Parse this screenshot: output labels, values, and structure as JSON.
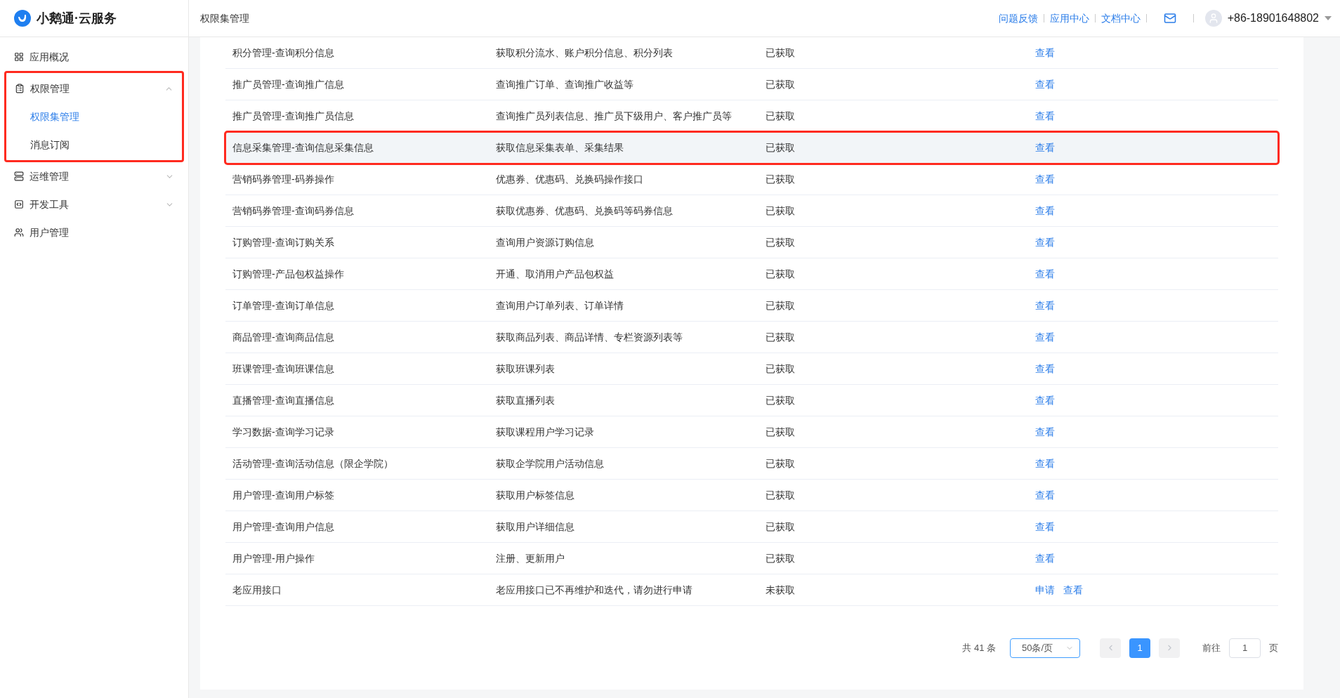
{
  "brand": {
    "name": "小鹅通·云服务"
  },
  "header": {
    "title": "权限集管理",
    "links": [
      "问题反馈",
      "应用中心",
      "文档中心"
    ],
    "user": "+86-18901648802"
  },
  "sidebar": {
    "items": [
      {
        "label": "应用概况"
      },
      {
        "label": "权限管理",
        "expanded": true,
        "annotated": true,
        "children": [
          {
            "label": "权限集管理",
            "selected": true
          },
          {
            "label": "消息订阅",
            "selected": false
          }
        ]
      },
      {
        "label": "运维管理",
        "expanded": false
      },
      {
        "label": "开发工具",
        "expanded": false
      },
      {
        "label": "用户管理"
      }
    ]
  },
  "table": {
    "rows": [
      {
        "name": "积分管理-查询积分信息",
        "description": "获取积分流水、账户积分信息、积分列表",
        "status": "已获取",
        "actions": [
          "查看"
        ],
        "highlighted": false,
        "annotated": false
      },
      {
        "name": "推广员管理-查询推广信息",
        "description": "查询推广订单、查询推广收益等",
        "status": "已获取",
        "actions": [
          "查看"
        ],
        "highlighted": false,
        "annotated": false
      },
      {
        "name": "推广员管理-查询推广员信息",
        "description": "查询推广员列表信息、推广员下级用户、客户推广员等",
        "status": "已获取",
        "actions": [
          "查看"
        ],
        "highlighted": false,
        "annotated": false
      },
      {
        "name": "信息采集管理-查询信息采集信息",
        "description": "获取信息采集表单、采集结果",
        "status": "已获取",
        "actions": [
          "查看"
        ],
        "highlighted": true,
        "annotated": true
      },
      {
        "name": "营销码券管理-码券操作",
        "description": "优惠券、优惠码、兑换码操作接口",
        "status": "已获取",
        "actions": [
          "查看"
        ],
        "highlighted": false,
        "annotated": false
      },
      {
        "name": "营销码券管理-查询码券信息",
        "description": "获取优惠券、优惠码、兑换码等码券信息",
        "status": "已获取",
        "actions": [
          "查看"
        ],
        "highlighted": false,
        "annotated": false
      },
      {
        "name": "订购管理-查询订购关系",
        "description": "查询用户资源订购信息",
        "status": "已获取",
        "actions": [
          "查看"
        ],
        "highlighted": false,
        "annotated": false
      },
      {
        "name": "订购管理-产品包权益操作",
        "description": "开通、取消用户产品包权益",
        "status": "已获取",
        "actions": [
          "查看"
        ],
        "highlighted": false,
        "annotated": false
      },
      {
        "name": "订单管理-查询订单信息",
        "description": "查询用户订单列表、订单详情",
        "status": "已获取",
        "actions": [
          "查看"
        ],
        "highlighted": false,
        "annotated": false
      },
      {
        "name": "商品管理-查询商品信息",
        "description": "获取商品列表、商品详情、专栏资源列表等",
        "status": "已获取",
        "actions": [
          "查看"
        ],
        "highlighted": false,
        "annotated": false
      },
      {
        "name": "班课管理-查询班课信息",
        "description": "获取班课列表",
        "status": "已获取",
        "actions": [
          "查看"
        ],
        "highlighted": false,
        "annotated": false
      },
      {
        "name": "直播管理-查询直播信息",
        "description": "获取直播列表",
        "status": "已获取",
        "actions": [
          "查看"
        ],
        "highlighted": false,
        "annotated": false
      },
      {
        "name": "学习数据-查询学习记录",
        "description": "获取课程用户学习记录",
        "status": "已获取",
        "actions": [
          "查看"
        ],
        "highlighted": false,
        "annotated": false
      },
      {
        "name": "活动管理-查询活动信息（限企学院）",
        "description": "获取企学院用户活动信息",
        "status": "已获取",
        "actions": [
          "查看"
        ],
        "highlighted": false,
        "annotated": false
      },
      {
        "name": "用户管理-查询用户标签",
        "description": "获取用户标签信息",
        "status": "已获取",
        "actions": [
          "查看"
        ],
        "highlighted": false,
        "annotated": false
      },
      {
        "name": "用户管理-查询用户信息",
        "description": "获取用户详细信息",
        "status": "已获取",
        "actions": [
          "查看"
        ],
        "highlighted": false,
        "annotated": false
      },
      {
        "name": "用户管理-用户操作",
        "description": "注册、更新用户",
        "status": "已获取",
        "actions": [
          "查看"
        ],
        "highlighted": false,
        "annotated": false
      },
      {
        "name": "老应用接口",
        "description": "老应用接口已不再维护和迭代，请勿进行申请",
        "status": "未获取",
        "actions": [
          "申请",
          "查看"
        ],
        "highlighted": false,
        "annotated": false
      }
    ]
  },
  "pagination": {
    "total": "共 41 条",
    "page_size": "50条/页",
    "pages": [
      {
        "label": "1",
        "selected": true
      }
    ],
    "goto_label": "前往",
    "goto_value": "1",
    "goto_suffix": "页"
  }
}
